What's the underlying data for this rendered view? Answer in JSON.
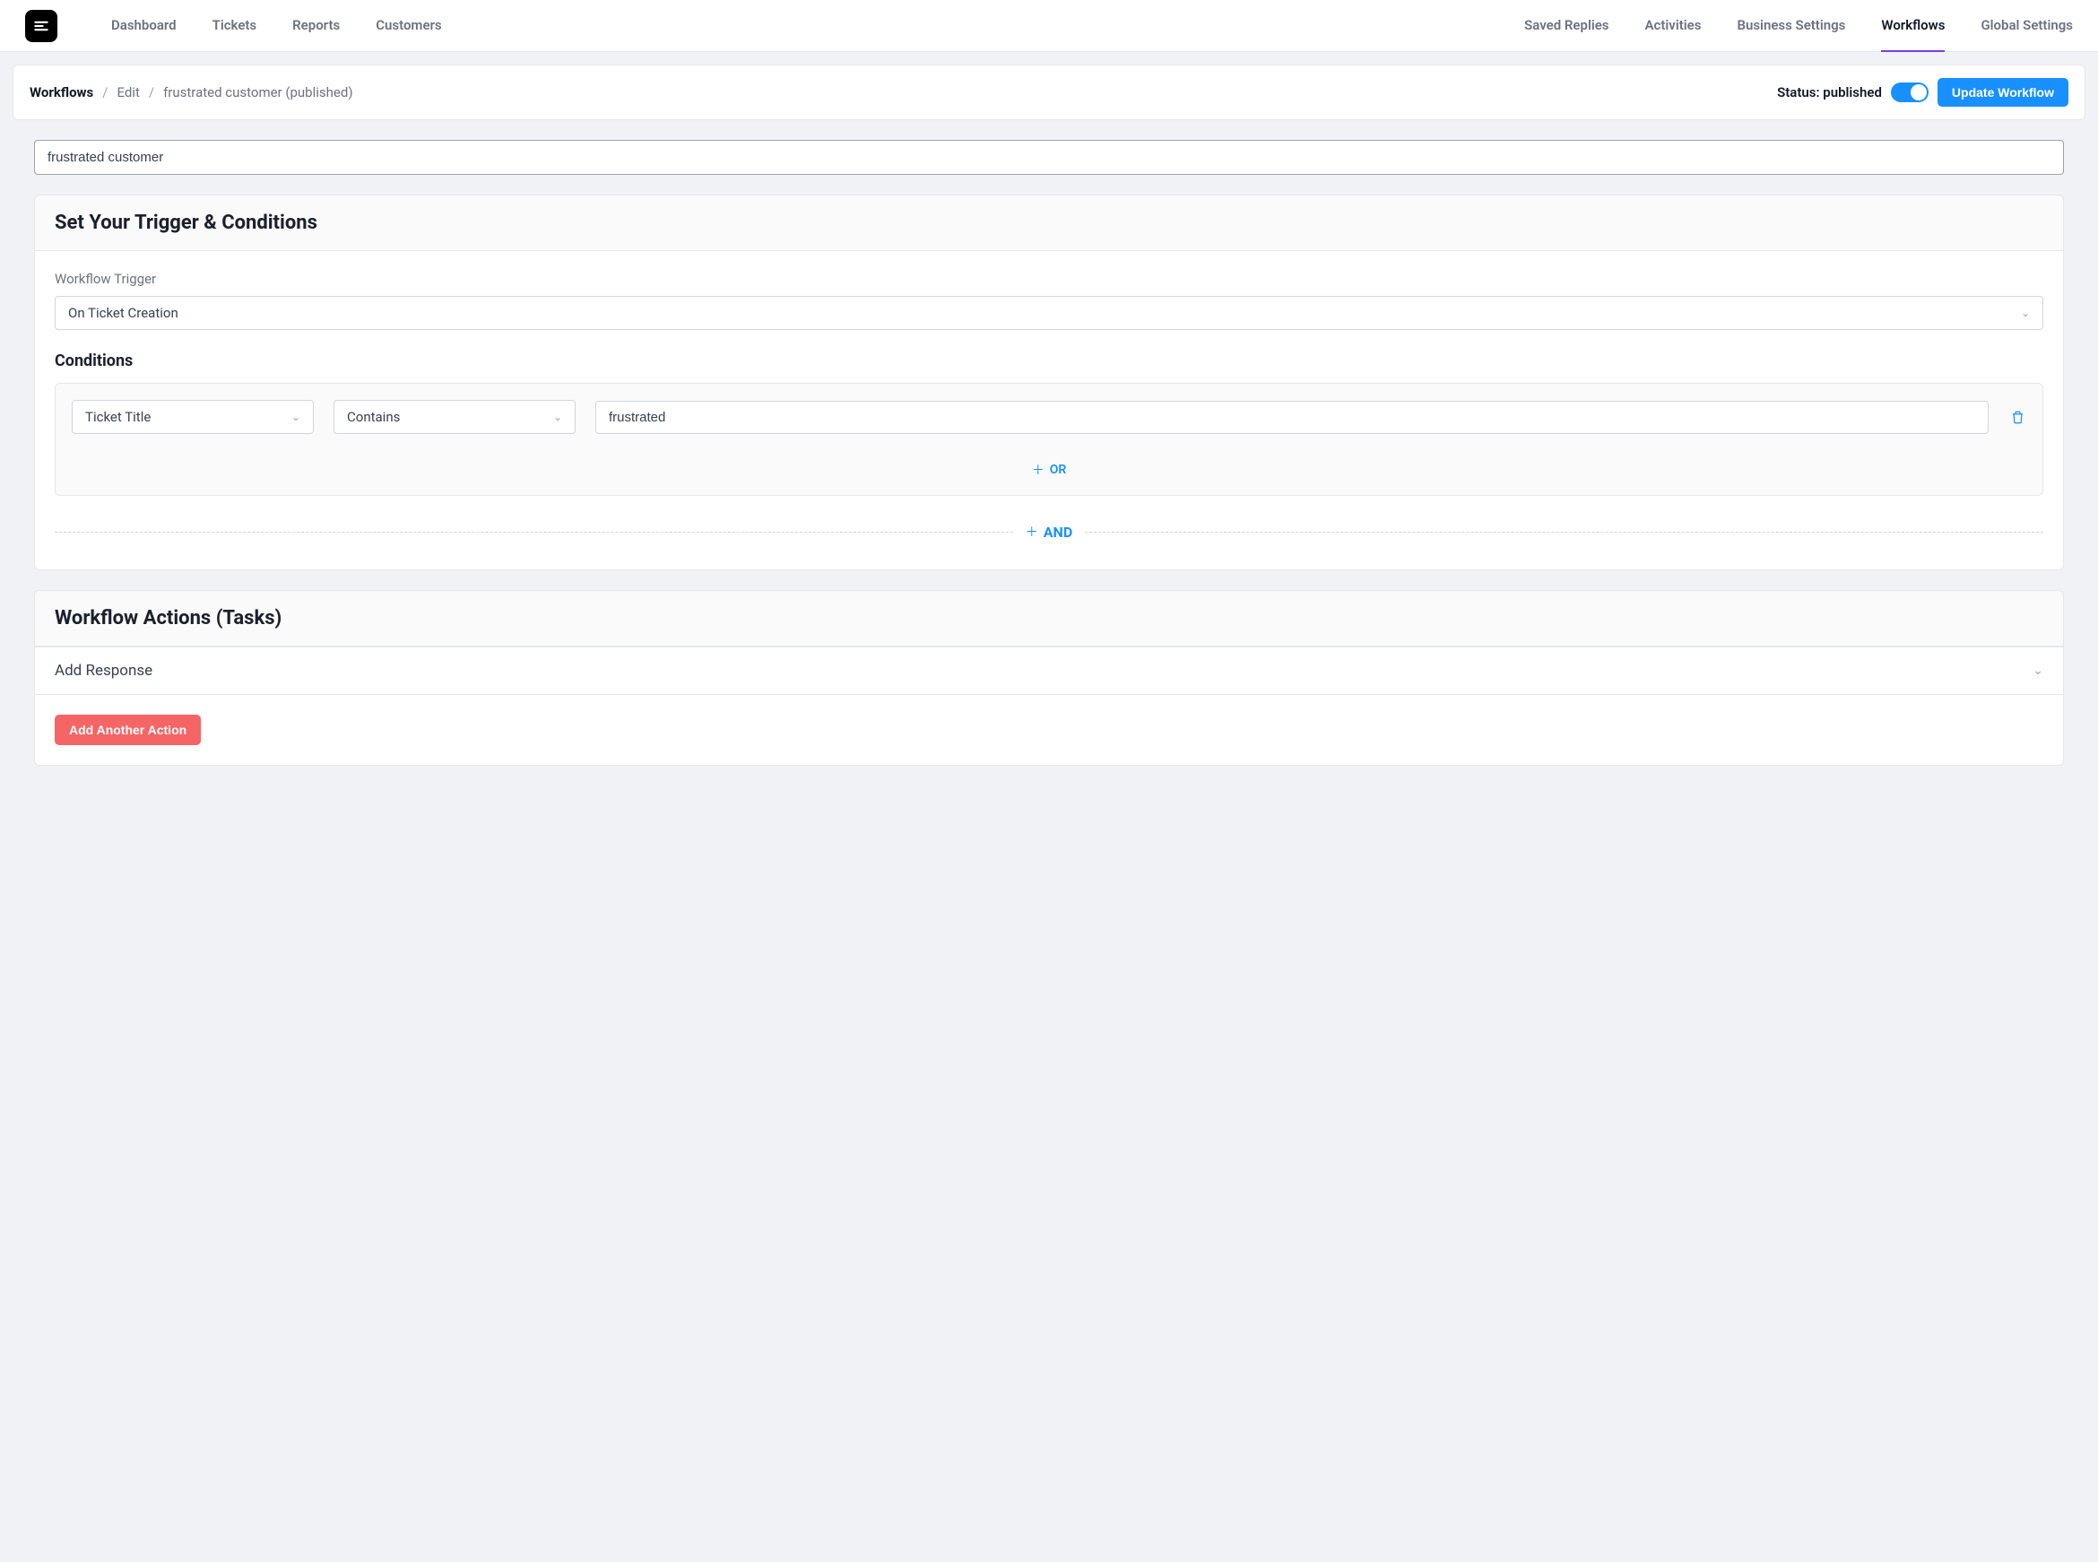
{
  "nav": {
    "left": [
      "Dashboard",
      "Tickets",
      "Reports",
      "Customers"
    ],
    "right": [
      "Saved Replies",
      "Activities",
      "Business Settings",
      "Workflows",
      "Global Settings"
    ],
    "active": "Workflows"
  },
  "breadcrumb": {
    "root": "Workflows",
    "edit": "Edit",
    "current": "frustrated customer (published)"
  },
  "status": {
    "label": "Status: published",
    "button": "Update Workflow"
  },
  "workflow": {
    "name": "frustrated customer"
  },
  "triggers": {
    "heading": "Set Your Trigger & Conditions",
    "trigger_label": "Workflow Trigger",
    "trigger_value": "On Ticket Creation",
    "conditions_heading": "Conditions",
    "condition": {
      "field": "Ticket Title",
      "operator": "Contains",
      "value": "frustrated"
    },
    "or_label": "OR",
    "and_label": "AND"
  },
  "actions": {
    "heading": "Workflow Actions (Tasks)",
    "items": [
      "Add Response"
    ],
    "add_button": "Add Another Action"
  }
}
